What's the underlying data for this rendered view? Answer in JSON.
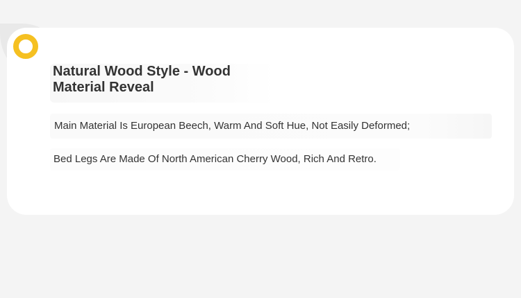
{
  "title": "Natural Wood Style - Wood Material Reveal",
  "details": [
    "Main Material Is European Beech, Warm And Soft Hue, Not Easily Deformed;",
    "Bed Legs Are Made Of North American Cherry Wood, Rich And Retro."
  ],
  "colors": {
    "accent": "#f5c021",
    "background": "#f4f4f4",
    "card": "#ffffff",
    "text": "#333333"
  },
  "icons": {
    "marker": "ring-icon"
  }
}
